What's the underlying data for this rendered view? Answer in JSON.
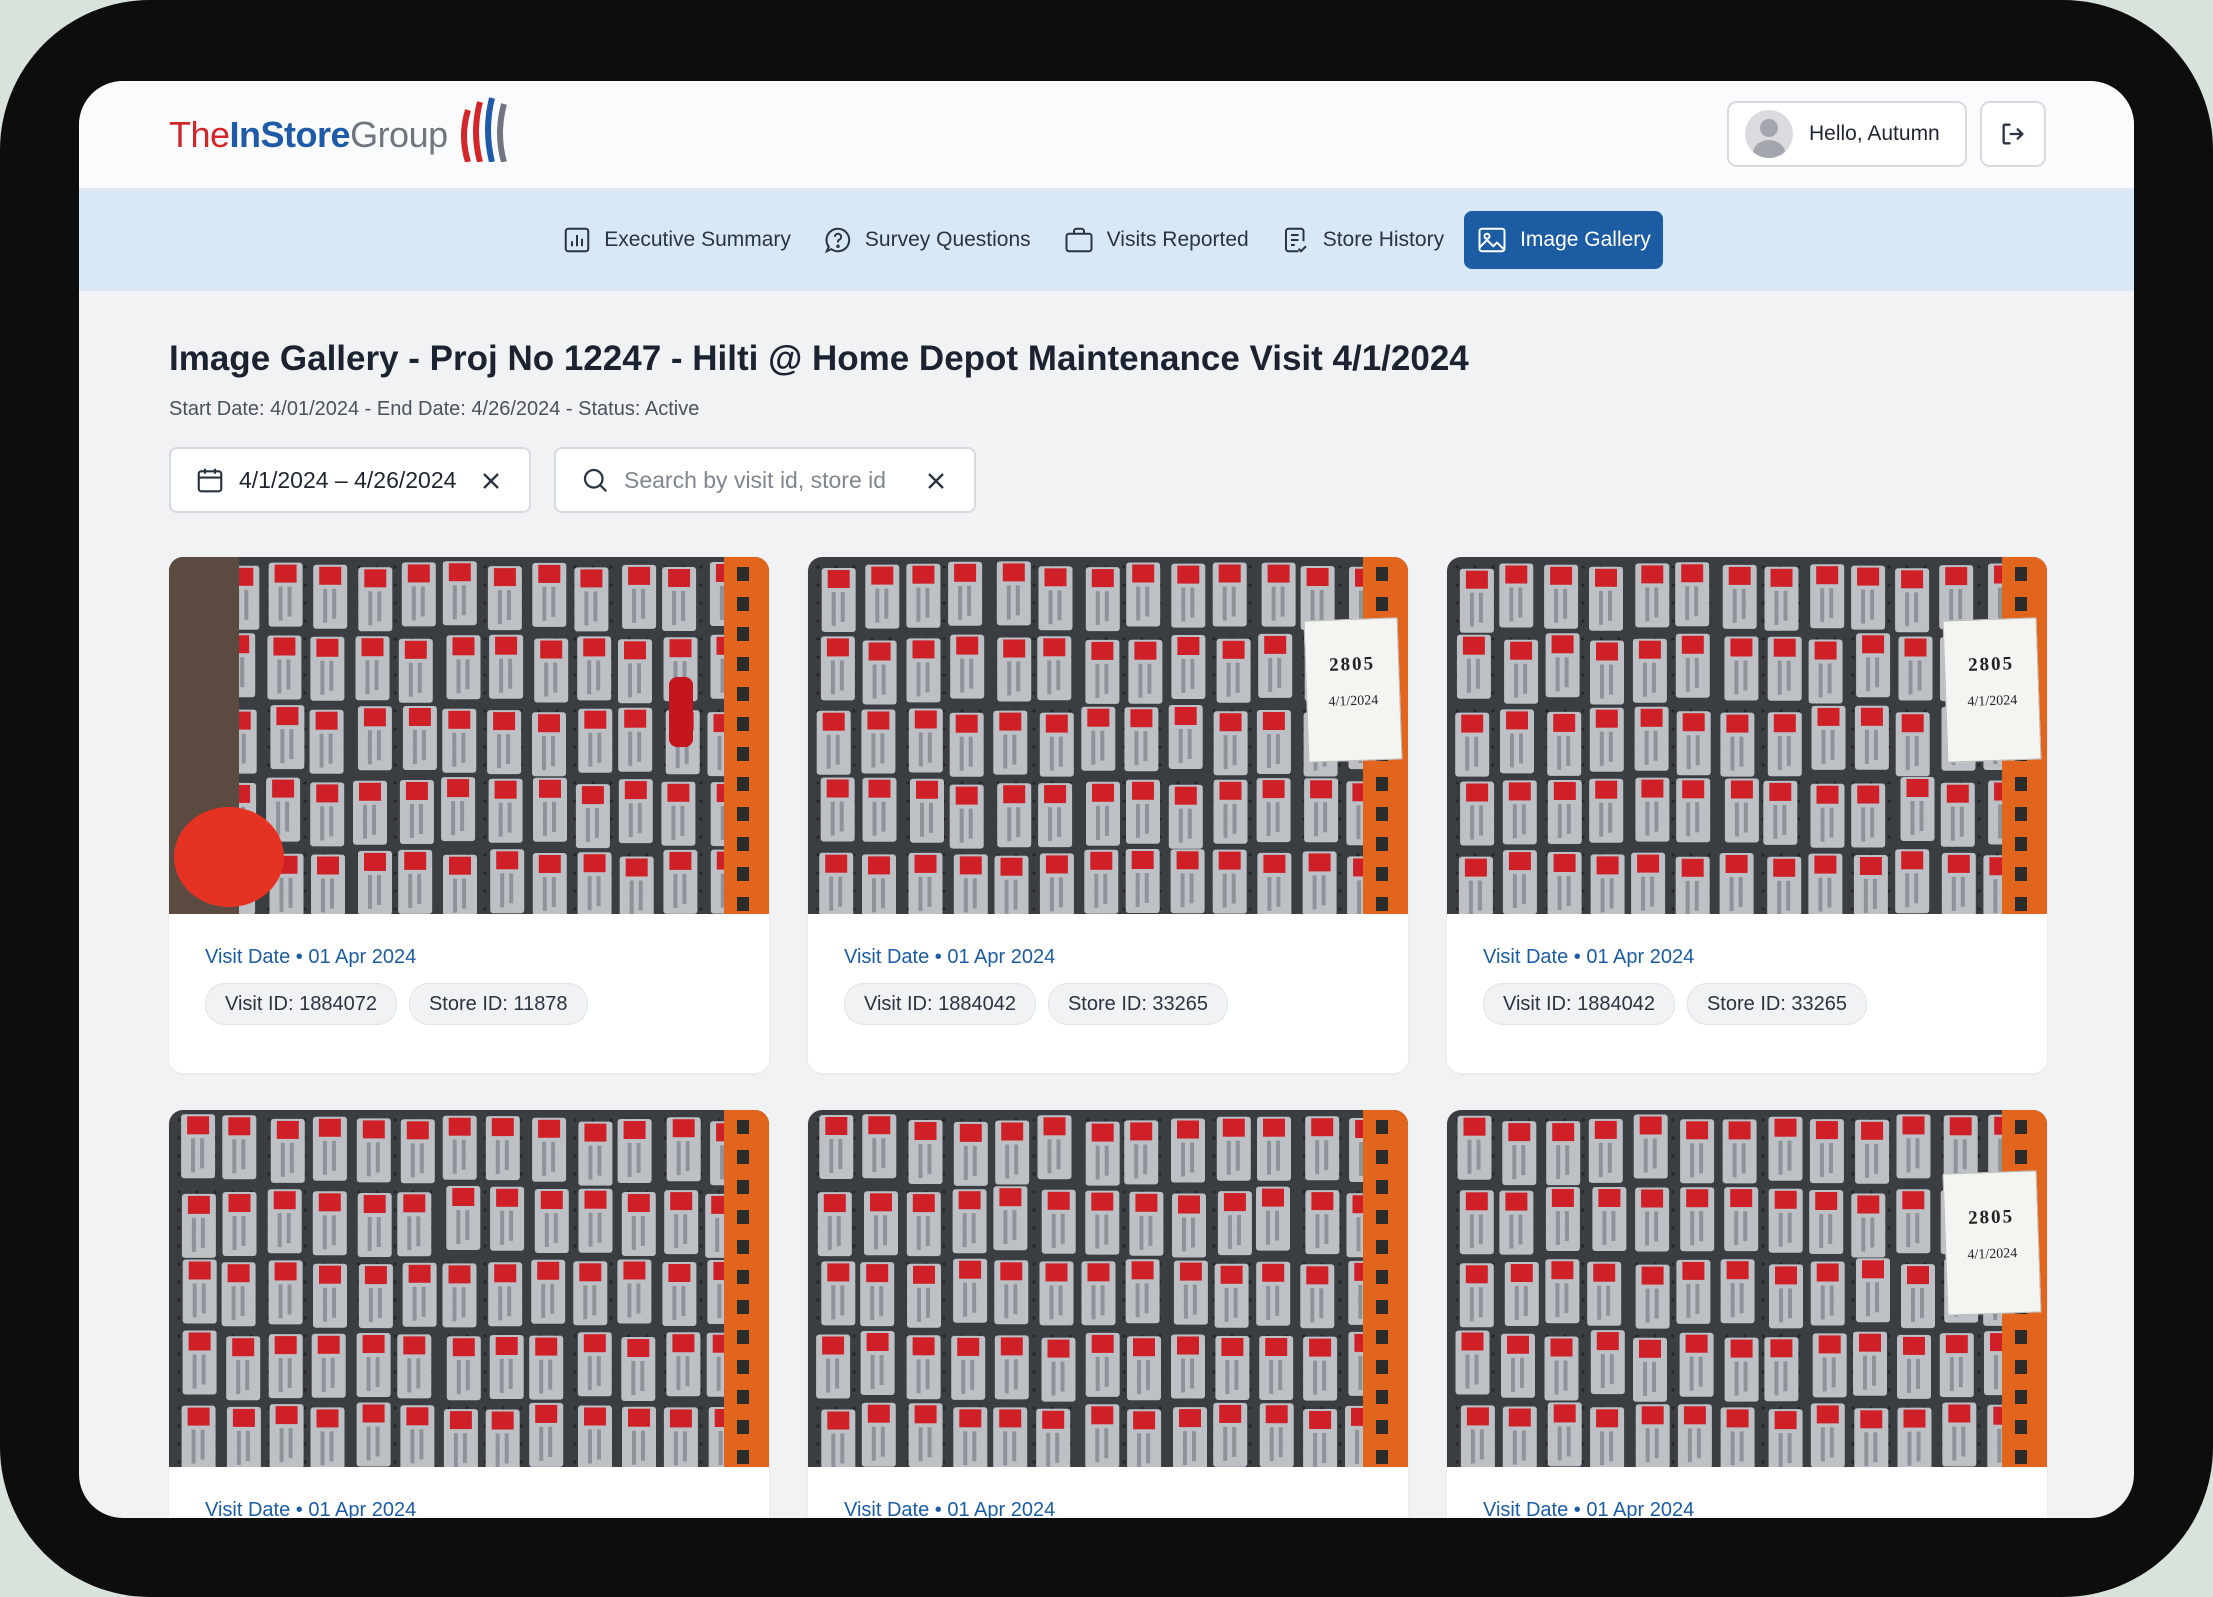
{
  "brand": {
    "the": "The",
    "in_store": "InStore",
    "group": "Group",
    "colors": {
      "red": "#d2272a",
      "blue": "#1f5aa8",
      "gray": "#6f7680"
    }
  },
  "user": {
    "greeting": "Hello, Autumn",
    "avatar_icon": "user-avatar-icon",
    "logout_icon": "logout-icon"
  },
  "nav": {
    "items": [
      {
        "label": "Executive Summary",
        "icon": "bar-chart-icon"
      },
      {
        "label": "Survey Questions",
        "icon": "question-bubble-icon"
      },
      {
        "label": "Visits Reported",
        "icon": "briefcase-icon"
      },
      {
        "label": "Store History",
        "icon": "document-check-icon"
      },
      {
        "label": "Image Gallery",
        "icon": "image-icon",
        "active": true
      }
    ],
    "active_color": "#1c5ca3"
  },
  "page": {
    "title": "Image Gallery - Proj No 12247 - Hilti @ Home Depot Maintenance Visit 4/1/2024",
    "subtitle": "Start Date: 4/01/2024 - End Date: 4/26/2024 - Status: Active"
  },
  "filters": {
    "date_range": "4/1/2024 – 4/26/2024",
    "search_placeholder": "Search by visit id, store id"
  },
  "gallery": [
    {
      "visit_date": "Visit Date • 01 Apr 2024",
      "visit_id": "Visit ID: 1884072",
      "store_id": "Store ID: 11878"
    },
    {
      "visit_date": "Visit Date • 01 Apr 2024",
      "visit_id": "Visit ID: 1884042",
      "store_id": "Store ID: 33265",
      "sign": [
        "2805",
        "4/1/2024"
      ]
    },
    {
      "visit_date": "Visit Date • 01 Apr 2024",
      "visit_id": "Visit ID: 1884042",
      "store_id": "Store ID: 33265",
      "sign": [
        "2805",
        "4/1/2024"
      ]
    },
    {
      "visit_date": "Visit Date • 01 Apr 2024"
    },
    {
      "visit_date": "Visit Date • 01 Apr 2024"
    },
    {
      "visit_date": "Visit Date • 01 Apr 2024",
      "sign": [
        "2805",
        "4/1/2024"
      ]
    }
  ]
}
